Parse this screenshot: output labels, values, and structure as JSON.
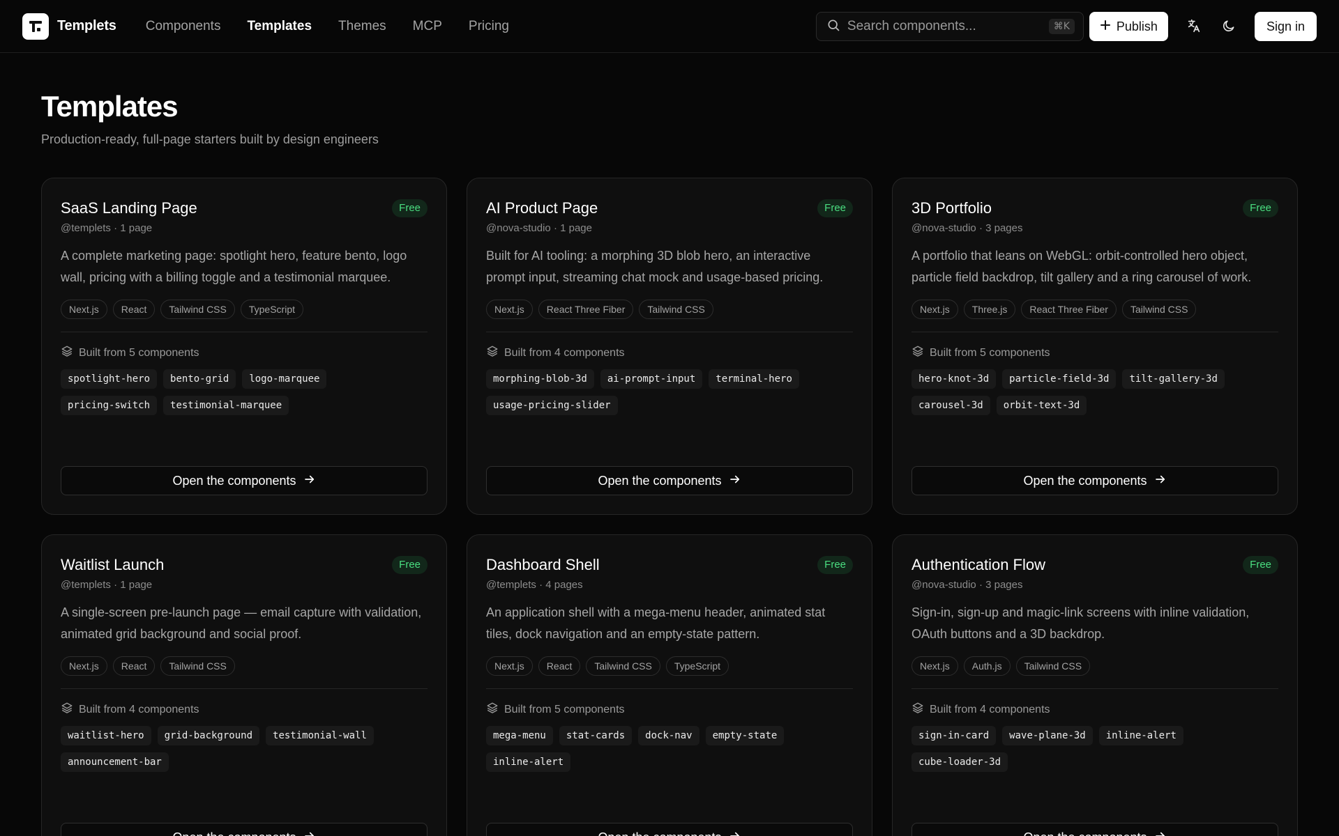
{
  "brand": {
    "name": "Templets"
  },
  "nav": [
    {
      "label": "Components",
      "active": false
    },
    {
      "label": "Templates",
      "active": true
    },
    {
      "label": "Themes",
      "active": false
    },
    {
      "label": "MCP",
      "active": false
    },
    {
      "label": "Pricing",
      "active": false
    }
  ],
  "search": {
    "placeholder": "Search components...",
    "shortcut": "⌘K"
  },
  "actions": {
    "publish_label": "Publish",
    "signin_label": "Sign in"
  },
  "page": {
    "title": "Templates",
    "subtitle": "Production-ready, full-page starters built by design engineers"
  },
  "colors": {
    "background": "#070707",
    "card": "#0f0f0f",
    "badge_text": "#4ade80",
    "badge_bg": "#12271a"
  },
  "cards": [
    {
      "title": "SaaS Landing Page",
      "badge": "Free",
      "meta": "@templets · 1 page",
      "description": "A complete marketing page: spotlight hero, feature bento, logo wall, pricing with a billing toggle and a testimonial marquee.",
      "tags": [
        "Next.js",
        "React",
        "Tailwind CSS",
        "TypeScript"
      ],
      "built_from": "Built from 5 components",
      "components": [
        "spotlight-hero",
        "bento-grid",
        "logo-marquee",
        "pricing-switch",
        "testimonial-marquee"
      ],
      "cta": "Open the components"
    },
    {
      "title": "AI Product Page",
      "badge": "Free",
      "meta": "@nova-studio · 1 page",
      "description": "Built for AI tooling: a morphing 3D blob hero, an interactive prompt input, streaming chat mock and usage-based pricing.",
      "tags": [
        "Next.js",
        "React Three Fiber",
        "Tailwind CSS"
      ],
      "built_from": "Built from 4 components",
      "components": [
        "morphing-blob-3d",
        "ai-prompt-input",
        "terminal-hero",
        "usage-pricing-slider"
      ],
      "cta": "Open the components"
    },
    {
      "title": "3D Portfolio",
      "badge": "Free",
      "meta": "@nova-studio · 3 pages",
      "description": "A portfolio that leans on WebGL: orbit-controlled hero object, particle field backdrop, tilt gallery and a ring carousel of work.",
      "tags": [
        "Next.js",
        "Three.js",
        "React Three Fiber",
        "Tailwind CSS"
      ],
      "built_from": "Built from 5 components",
      "components": [
        "hero-knot-3d",
        "particle-field-3d",
        "tilt-gallery-3d",
        "carousel-3d",
        "orbit-text-3d"
      ],
      "cta": "Open the components"
    },
    {
      "title": "Waitlist Launch",
      "badge": "Free",
      "meta": "@templets · 1 page",
      "description": "A single-screen pre-launch page — email capture with validation, animated grid background and social proof.",
      "tags": [
        "Next.js",
        "React",
        "Tailwind CSS"
      ],
      "built_from": "Built from 4 components",
      "components": [
        "waitlist-hero",
        "grid-background",
        "testimonial-wall",
        "announcement-bar"
      ],
      "cta": "Open the components"
    },
    {
      "title": "Dashboard Shell",
      "badge": "Free",
      "meta": "@templets · 4 pages",
      "description": "An application shell with a mega-menu header, animated stat tiles, dock navigation and an empty-state pattern.",
      "tags": [
        "Next.js",
        "React",
        "Tailwind CSS",
        "TypeScript"
      ],
      "built_from": "Built from 5 components",
      "components": [
        "mega-menu",
        "stat-cards",
        "dock-nav",
        "empty-state",
        "inline-alert"
      ],
      "cta": "Open the components"
    },
    {
      "title": "Authentication Flow",
      "badge": "Free",
      "meta": "@nova-studio · 3 pages",
      "description": "Sign-in, sign-up and magic-link screens with inline validation, OAuth buttons and a 3D backdrop.",
      "tags": [
        "Next.js",
        "Auth.js",
        "Tailwind CSS"
      ],
      "built_from": "Built from 4 components",
      "components": [
        "sign-in-card",
        "wave-plane-3d",
        "inline-alert",
        "cube-loader-3d"
      ],
      "cta": "Open the components"
    }
  ]
}
